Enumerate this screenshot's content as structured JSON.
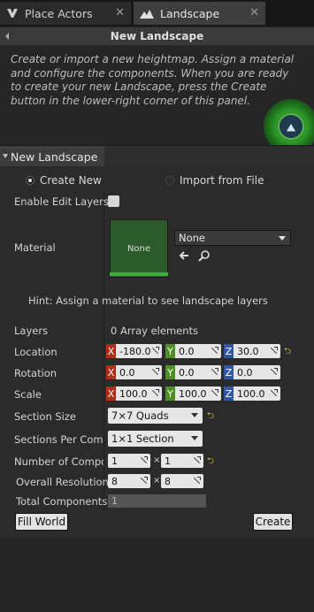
{
  "tabs": [
    {
      "label": "Place Actors",
      "icon": "place-actors-icon",
      "closable": true
    },
    {
      "label": "Landscape",
      "icon": "landscape-icon",
      "closable": true
    }
  ],
  "header": {
    "title": "New Landscape"
  },
  "description": "Create or import a new heightmap.  Assign a material and configure the components.  When you are ready to create your new Landscape, press the Create button in the lower-right corner of this panel.",
  "section": {
    "title": "New Landscape"
  },
  "mode": {
    "options": [
      "Create New",
      "Import from File"
    ],
    "selected": "Create New"
  },
  "fields": {
    "enable_edit_layers": {
      "label": "Enable Edit Layers",
      "checked": false
    },
    "material": {
      "label": "Material",
      "thumbnail_text": "None",
      "value": "None"
    },
    "hint": "Hint: Assign a material to see landscape layers",
    "layers": {
      "label": "Layers",
      "value": "0 Array elements"
    },
    "location": {
      "label": "Location",
      "x": "-180.0",
      "y": "0.0",
      "z": "30.0"
    },
    "rotation": {
      "label": "Rotation",
      "x": "0.0",
      "y": "0.0",
      "z": "0.0"
    },
    "scale": {
      "label": "Scale",
      "x": "100.0",
      "y": "100.0",
      "z": "100.0"
    },
    "section_size": {
      "label": "Section Size",
      "value": "7×7 Quads"
    },
    "sections_per_component": {
      "label": "Sections Per Component",
      "value": "1×1 Section"
    },
    "number_of_components": {
      "label": "Number of Components",
      "x": "1",
      "y": "1"
    },
    "overall_resolution": {
      "label": "Overall Resolution",
      "x": "8",
      "y": "8"
    },
    "total_components": {
      "label": "Total Components",
      "value": "1"
    }
  },
  "axis_labels": {
    "x": "X",
    "y": "Y",
    "z": "Z"
  },
  "multiply_symbol": "×",
  "buttons": {
    "fill_world": "Fill World",
    "create": "Create"
  },
  "colors": {
    "x_axis": "#b62a1a",
    "y_axis": "#4e8f25",
    "z_axis": "#2e58a8",
    "reset_arrow": "#e0c33a",
    "material_bar": "#3ab03a"
  }
}
